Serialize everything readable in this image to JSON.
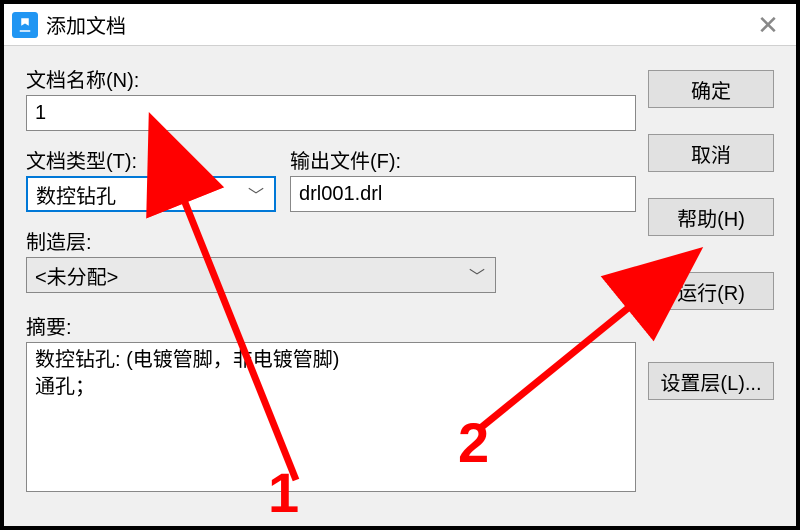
{
  "window": {
    "title": "添加文档"
  },
  "labels": {
    "docName": "文档名称(N):",
    "docType": "文档类型(T):",
    "outputFile": "输出文件(F):",
    "mfgLayer": "制造层:",
    "summary": "摘要:"
  },
  "fields": {
    "docName": "1",
    "docType": "数控钻孔",
    "outputFile": "drl001.drl",
    "mfgLayer": "<未分配>",
    "summary": "数控钻孔: (电镀管脚，非电镀管脚)\n通孔；"
  },
  "buttons": {
    "ok": "确定",
    "cancel": "取消",
    "help": "帮助(H)",
    "run": "运行(R)",
    "setLayer": "设置层(L)..."
  },
  "annotations": {
    "one": "1",
    "two": "2"
  }
}
